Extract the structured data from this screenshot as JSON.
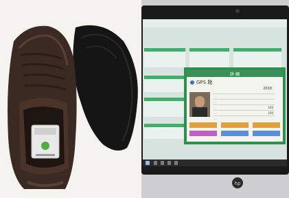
{
  "laptop": {
    "brand": "hp",
    "dialog": {
      "header": "詳 細",
      "title": "GPS 靴",
      "id_value": "2018",
      "rows": [
        "...",
        "...",
        "...",
        "...",
        "..."
      ],
      "values": [
        "100",
        "100"
      ],
      "button_color": "#e0a040",
      "button_alt_color": "#c060c0"
    },
    "dashboard_accent": "#3fae6a",
    "dialog_border": "#2f8f4f"
  },
  "device": {
    "indicator_color": "#4caf3f"
  }
}
